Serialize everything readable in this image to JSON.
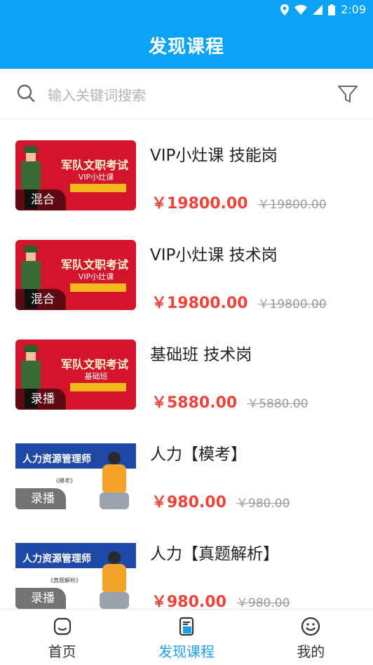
{
  "status_bar": {
    "time": "2:09"
  },
  "header": {
    "title": "发现课程"
  },
  "search": {
    "placeholder": "输入关键词搜索"
  },
  "courses": [
    {
      "title": "VIP小灶课  技能岗",
      "price": "￥19800.00",
      "original_price": "￥19800.00",
      "tag": "混合",
      "thumb_title": "军队文职考试",
      "thumb_sub": "VIP小灶课",
      "thumb_style": "red"
    },
    {
      "title": "VIP小灶课  技术岗",
      "price": "￥19800.00",
      "original_price": "￥19800.00",
      "tag": "混合",
      "thumb_title": "军队文职考试",
      "thumb_sub": "VIP小灶课",
      "thumb_style": "red"
    },
    {
      "title": "基础班 技术岗",
      "price": "￥5880.00",
      "original_price": "￥5880.00",
      "tag": "录播",
      "thumb_title": "军队文职考试",
      "thumb_sub": "基础班",
      "thumb_style": "red"
    },
    {
      "title": "人力【模考】",
      "price": "￥980.00",
      "original_price": "￥980.00",
      "tag": "录播",
      "thumb_title": "人力资源管理师",
      "thumb_sub": "《模考》",
      "thumb_style": "blue"
    },
    {
      "title": "人力【真题解析】",
      "price": "￥980.00",
      "original_price": "￥980.00",
      "tag": "录播",
      "thumb_title": "人力资源管理师",
      "thumb_sub": "《真题解析》",
      "thumb_style": "blue"
    }
  ],
  "bottom_nav": [
    {
      "label": "首页",
      "icon": "home-icon",
      "active": false
    },
    {
      "label": "发现课程",
      "icon": "discover-icon",
      "active": true
    },
    {
      "label": "我的",
      "icon": "smiley-icon",
      "active": false
    }
  ],
  "colors": {
    "brand": "#0aa3f5",
    "price": "#f0413a",
    "active_tab": "#1a9ef0"
  }
}
